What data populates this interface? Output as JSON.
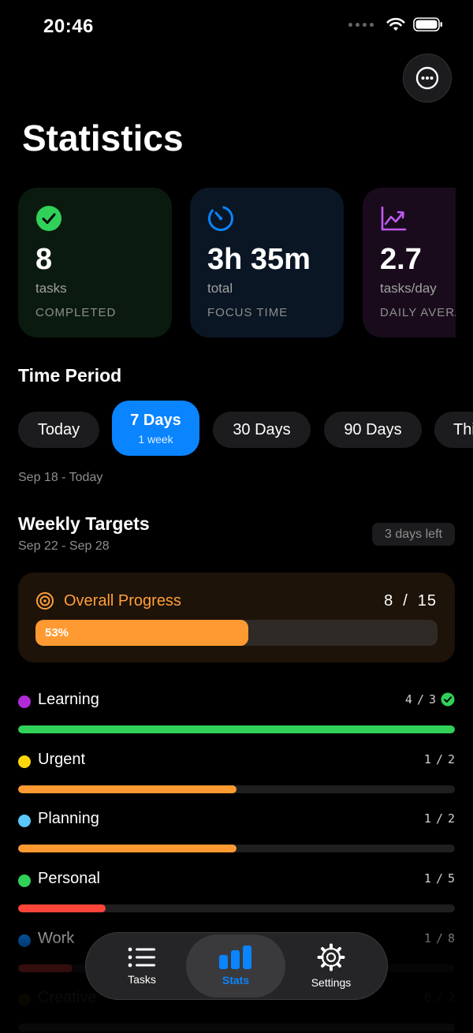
{
  "status_bar": {
    "time": "20:46"
  },
  "header": {
    "title": "Statistics"
  },
  "stat_cards": [
    {
      "value": "8",
      "unit": "tasks",
      "caption": "COMPLETED",
      "icon": "checkmark-circle-icon",
      "accent": "#30d158",
      "bg": "#0b1a0e"
    },
    {
      "value": "3h 35m",
      "unit": "total",
      "caption": "FOCUS TIME",
      "icon": "timer-icon",
      "accent": "#0a84ff",
      "bg": "#0a1624"
    },
    {
      "value": "2.7",
      "unit": "tasks/day",
      "caption": "DAILY AVERAGE",
      "icon": "chart-line-icon",
      "accent": "#bf5af2",
      "bg": "#190b1c"
    }
  ],
  "time_period": {
    "title": "Time Period",
    "options": [
      {
        "label": "Today"
      },
      {
        "label": "7 Days",
        "sublabel": "1 week",
        "selected": true
      },
      {
        "label": "30 Days"
      },
      {
        "label": "90 Days"
      },
      {
        "label": "This Year"
      }
    ],
    "range_text": "Sep 18 - Today"
  },
  "weekly_targets": {
    "title": "Weekly Targets",
    "date_range": "Sep 22 - Sep 28",
    "days_left": "3 days left",
    "overall": {
      "label": "Overall Progress",
      "done": "8",
      "sep": "/",
      "total": "15",
      "percent_label": "53%",
      "fraction": 0.53,
      "accent": "#ff9f3a"
    },
    "categories": [
      {
        "name": "Learning",
        "done": "4",
        "target": "3",
        "progress": 1.0,
        "dot": "#af2bd6",
        "bar": "#30d158",
        "complete": true
      },
      {
        "name": "Urgent",
        "done": "1",
        "target": "2",
        "progress": 0.5,
        "dot": "#ffd60a",
        "bar": "#ff9a32"
      },
      {
        "name": "Planning",
        "done": "1",
        "target": "2",
        "progress": 0.5,
        "dot": "#5ac8fa",
        "bar": "#ff9a32"
      },
      {
        "name": "Personal",
        "done": "1",
        "target": "5",
        "progress": 0.2,
        "dot": "#30d158",
        "bar": "#ff453a"
      },
      {
        "name": "Work",
        "done": "1",
        "target": "8",
        "progress": 0.125,
        "dot": "#0a84ff",
        "bar": "#ff453a"
      },
      {
        "name": "Creative",
        "done": "0",
        "target": "2",
        "progress": 0.0,
        "dot": "#ff9f0a",
        "bar": "#ff453a"
      }
    ]
  },
  "tab_bar": {
    "tabs": [
      {
        "label": "Tasks",
        "icon": "list-icon"
      },
      {
        "label": "Stats",
        "icon": "bar-chart-icon",
        "selected": true
      },
      {
        "label": "Settings",
        "icon": "gear-icon"
      }
    ]
  }
}
